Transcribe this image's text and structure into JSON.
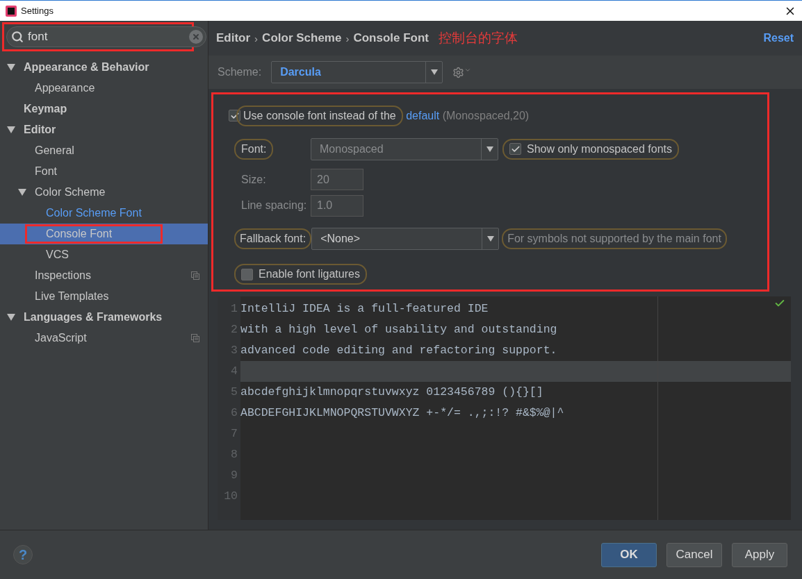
{
  "window": {
    "title": "Settings"
  },
  "search": {
    "value": "font",
    "annotated": true
  },
  "tree": [
    {
      "label": "Appearance & Behavior",
      "expanded": true,
      "selected": false,
      "matched": false,
      "annotated": false,
      "copy_icon": false,
      "children": [
        {
          "label": "Appearance",
          "selected": false,
          "matched": false,
          "annotated": false,
          "copy_icon": false
        }
      ]
    },
    {
      "label": "Keymap",
      "selected": false,
      "matched": false,
      "annotated": false,
      "copy_icon": false
    },
    {
      "label": "Editor",
      "expanded": true,
      "selected": false,
      "matched": false,
      "annotated": false,
      "copy_icon": false,
      "children": [
        {
          "label": "General",
          "selected": false,
          "matched": false,
          "annotated": false,
          "copy_icon": false
        },
        {
          "label": "Font",
          "selected": false,
          "matched": false,
          "annotated": false,
          "copy_icon": false
        },
        {
          "label": "Color Scheme",
          "expanded": true,
          "selected": false,
          "matched": false,
          "annotated": false,
          "copy_icon": false,
          "children": [
            {
              "label": "Color Scheme Font",
              "selected": false,
              "matched": true,
              "annotated": false,
              "copy_icon": false
            },
            {
              "label": "Console Font",
              "selected": true,
              "matched": false,
              "annotated": true,
              "copy_icon": false
            },
            {
              "label": "VCS",
              "selected": false,
              "matched": false,
              "annotated": false,
              "copy_icon": false
            }
          ]
        },
        {
          "label": "Inspections",
          "selected": false,
          "matched": false,
          "annotated": false,
          "copy_icon": true
        },
        {
          "label": "Live Templates",
          "selected": false,
          "matched": false,
          "annotated": false,
          "copy_icon": false
        }
      ]
    },
    {
      "label": "Languages & Frameworks",
      "expanded": true,
      "selected": false,
      "matched": false,
      "annotated": false,
      "copy_icon": false,
      "children": [
        {
          "label": "JavaScript",
          "selected": false,
          "matched": false,
          "annotated": false,
          "copy_icon": true
        }
      ]
    }
  ],
  "breadcrumb": {
    "path": [
      "Editor",
      "Color Scheme",
      "Console Font"
    ],
    "separators": [
      "›",
      "›"
    ],
    "note": "控制台的字体",
    "reset": "Reset"
  },
  "scheme": {
    "label": "Scheme:",
    "value": "Darcula"
  },
  "console_panel": {
    "annotated": true,
    "use_console_font": {
      "label": "Use console font instead of the",
      "link": "default",
      "hint": "(Monospaced,20)",
      "checked": true,
      "circled": true
    },
    "font": {
      "label": "Font:",
      "value": "Monospaced",
      "disabled": true,
      "circled": true
    },
    "show_mono": {
      "label": "Show only monospaced fonts",
      "checked": true,
      "circled": true
    },
    "size": {
      "label": "Size:",
      "value": "20",
      "disabled": true
    },
    "line_spacing": {
      "label": "Line spacing:",
      "value": "1.0",
      "disabled": true
    },
    "fallback": {
      "label": "Fallback font:",
      "value": "<None>",
      "hint": "For symbols not supported by the main font",
      "disabled": false,
      "circled": true
    },
    "ligatures": {
      "label": "Enable font ligatures",
      "checked": false,
      "circled": true
    }
  },
  "preview": {
    "lines": [
      {
        "number": "1",
        "text": "IntelliJ IDEA is a full-featured IDE",
        "current": false
      },
      {
        "number": "2",
        "text": "with a high level of usability and outstanding",
        "current": false
      },
      {
        "number": "3",
        "text": "advanced code editing and refactoring support.",
        "current": false
      },
      {
        "number": "4",
        "current": true
      },
      {
        "number": "5",
        "text": "abcdefghijklmnopqrstuvwxyz 0123456789 (){}[]",
        "current": false
      },
      {
        "number": "6",
        "text": "ABCDEFGHIJKLMNOPQRSTUVWXYZ +-*/= .,;:!? #&$%@|^",
        "current": false
      },
      {
        "number": "7",
        "current": false
      },
      {
        "number": "8",
        "current": false
      },
      {
        "number": "9",
        "current": false
      },
      {
        "number": "10",
        "current": false
      }
    ]
  },
  "help": {
    "label": "?"
  },
  "buttons": [
    {
      "label": "OK",
      "default": true
    },
    {
      "label": "Cancel",
      "default": false
    },
    {
      "label": "Apply",
      "default": false
    }
  ]
}
